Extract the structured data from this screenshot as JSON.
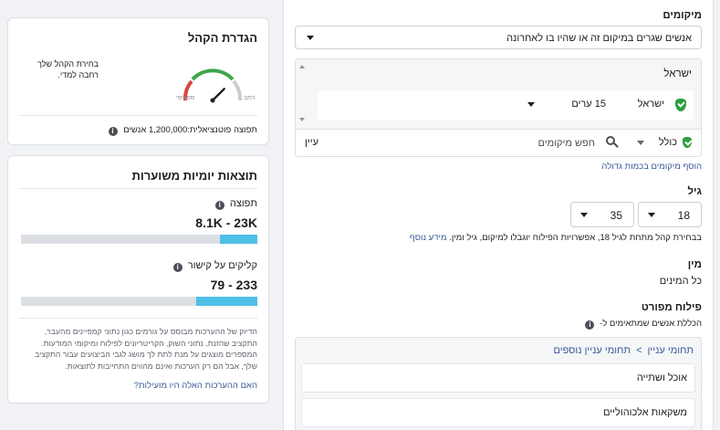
{
  "audience_card": {
    "title": "הגדרת הקהל",
    "description_line1": "בחירת הקהל שלך",
    "description_line2": "רחבה למדי.",
    "gauge_left_label": "ספציפי",
    "gauge_right_label": "רחב",
    "gauge_level": 0.75,
    "reach_text": "תפוצה פוטנציאלית:1,200,000 אנשים"
  },
  "results_card": {
    "title": "תוצאות יומיות משוערות",
    "reach_label": "תפוצה",
    "reach_value": "8.1K - 23K",
    "reach_bar": {
      "from": 0.0,
      "to": 0.16
    },
    "clicks_label": "קליקים על קישור",
    "clicks_value": "233 - 79",
    "clicks_bar": {
      "from": 0.0,
      "to": 0.26
    },
    "disclaimer_l1": "הדיוק של ההערכות מבוסס על גורמים כגון נתוני קמפיינים מהעבר,",
    "disclaimer_l2": "התקציב שהזנת, נתוני השוק, הקריטריונים לפילוח ומיקומי המודעות.",
    "disclaimer_l3": "המספרים מוצגים על מנת לתת לך מושג לגבי הביצועים עבור התקציב",
    "disclaimer_l4": "שלך, אבל הם רק הערכות ואינם מהווים התחייבות לתוצאות.",
    "feedback_link": "האם ההערכות האלה היו מועילות?"
  },
  "locations": {
    "label": "מיקומים",
    "dropdown_value": "אנשים שגרים במיקום זה או שהיו בו לאחרונה",
    "country": "ישראל",
    "item_name": "ישראל",
    "item_radius": "15 ערים",
    "include_label": "כולל",
    "search_placeholder": "חפש מיקומים",
    "browse_label": "עיין",
    "bulk_link": "הוסף מיקומים בכמות גדולה"
  },
  "age": {
    "label": "גיל",
    "min": "18",
    "max": "35",
    "note": "בבחירת קהל מתחת לגיל 18, אפשרויות הפילוח יוגבלו למיקום, גיל ומין.",
    "learn_more": "מידע נוסף"
  },
  "gender": {
    "label": "מין",
    "value": "כל המינים"
  },
  "detailed": {
    "label": "פילוח מפורט",
    "include_note": "הכללת אנשים שמתאימים ל-",
    "breadcrumb_a": "תחומי עניין",
    "breadcrumb_sep": ">",
    "breadcrumb_b": "תחומי עניין נוספים",
    "items": [
      "אוכל ושתייה",
      "משקאות אלכוהוליים"
    ]
  },
  "colors": {
    "accent": "#385898",
    "bar_fill": "#4ec0e8",
    "shield": "#2e9e3e",
    "gauge_red": "#d6463d",
    "gauge_green": "#3da64a"
  }
}
